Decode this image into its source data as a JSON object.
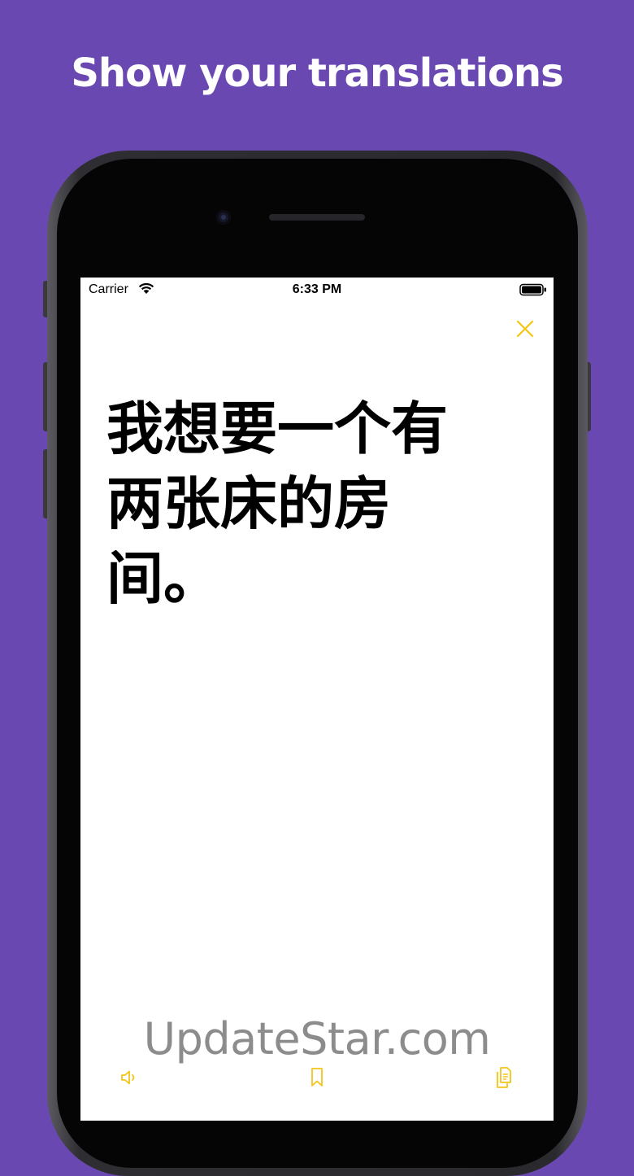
{
  "promo": {
    "headline": "Show your translations"
  },
  "status_bar": {
    "carrier": "Carrier",
    "time": "6:33 PM",
    "wifi_icon": "wifi-icon",
    "battery_icon": "battery-icon"
  },
  "translation": {
    "text": "我想要一个有两张床的房间。"
  },
  "toolbar": {
    "close_icon": "close-icon",
    "speaker_icon": "speaker-icon",
    "bookmark_icon": "bookmark-icon",
    "copy_icon": "copy-icon"
  },
  "watermark": {
    "text": "UpdateStar.com"
  },
  "colors": {
    "background": "#6a48b2",
    "accent": "#f5c518",
    "screen": "#ffffff",
    "text": "#000000"
  }
}
